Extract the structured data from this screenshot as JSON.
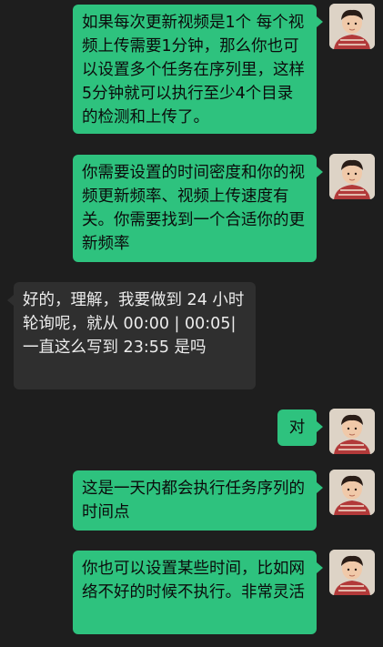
{
  "messages": [
    {
      "side": "out",
      "text": "如果每次更新视频是1个 每个视频上传需要1分钟，那么你也可以设置多个任务在序列里，这样5分钟就可以执行至少4个目录的检测和上传了。",
      "avatar": "child-avatar-icon"
    },
    {
      "side": "out",
      "text": "你需要设置的时间密度和你的视频更新频率、视频上传速度有关。你需要找到一个合适你的更新频率",
      "avatar": "child-avatar-icon"
    },
    {
      "side": "in",
      "text": "好的，理解，我要做到 24 小时轮询呢，就从 00:00 | 00:05| 一直这么写到 23:55 是吗"
    },
    {
      "side": "out",
      "text": "对",
      "avatar": "child-avatar-icon"
    },
    {
      "side": "out",
      "text": "这是一天内都会执行任务序列的时间点",
      "avatar": "child-avatar-icon"
    },
    {
      "side": "out",
      "text": "你也可以设置某些时间，比如网络不好的时候不执行。非常灵活",
      "avatar": "child-avatar-icon"
    }
  ],
  "colors": {
    "background": "#1e1e1e",
    "outgoing": "#2ec27e",
    "incoming": "#2f2f2f"
  }
}
